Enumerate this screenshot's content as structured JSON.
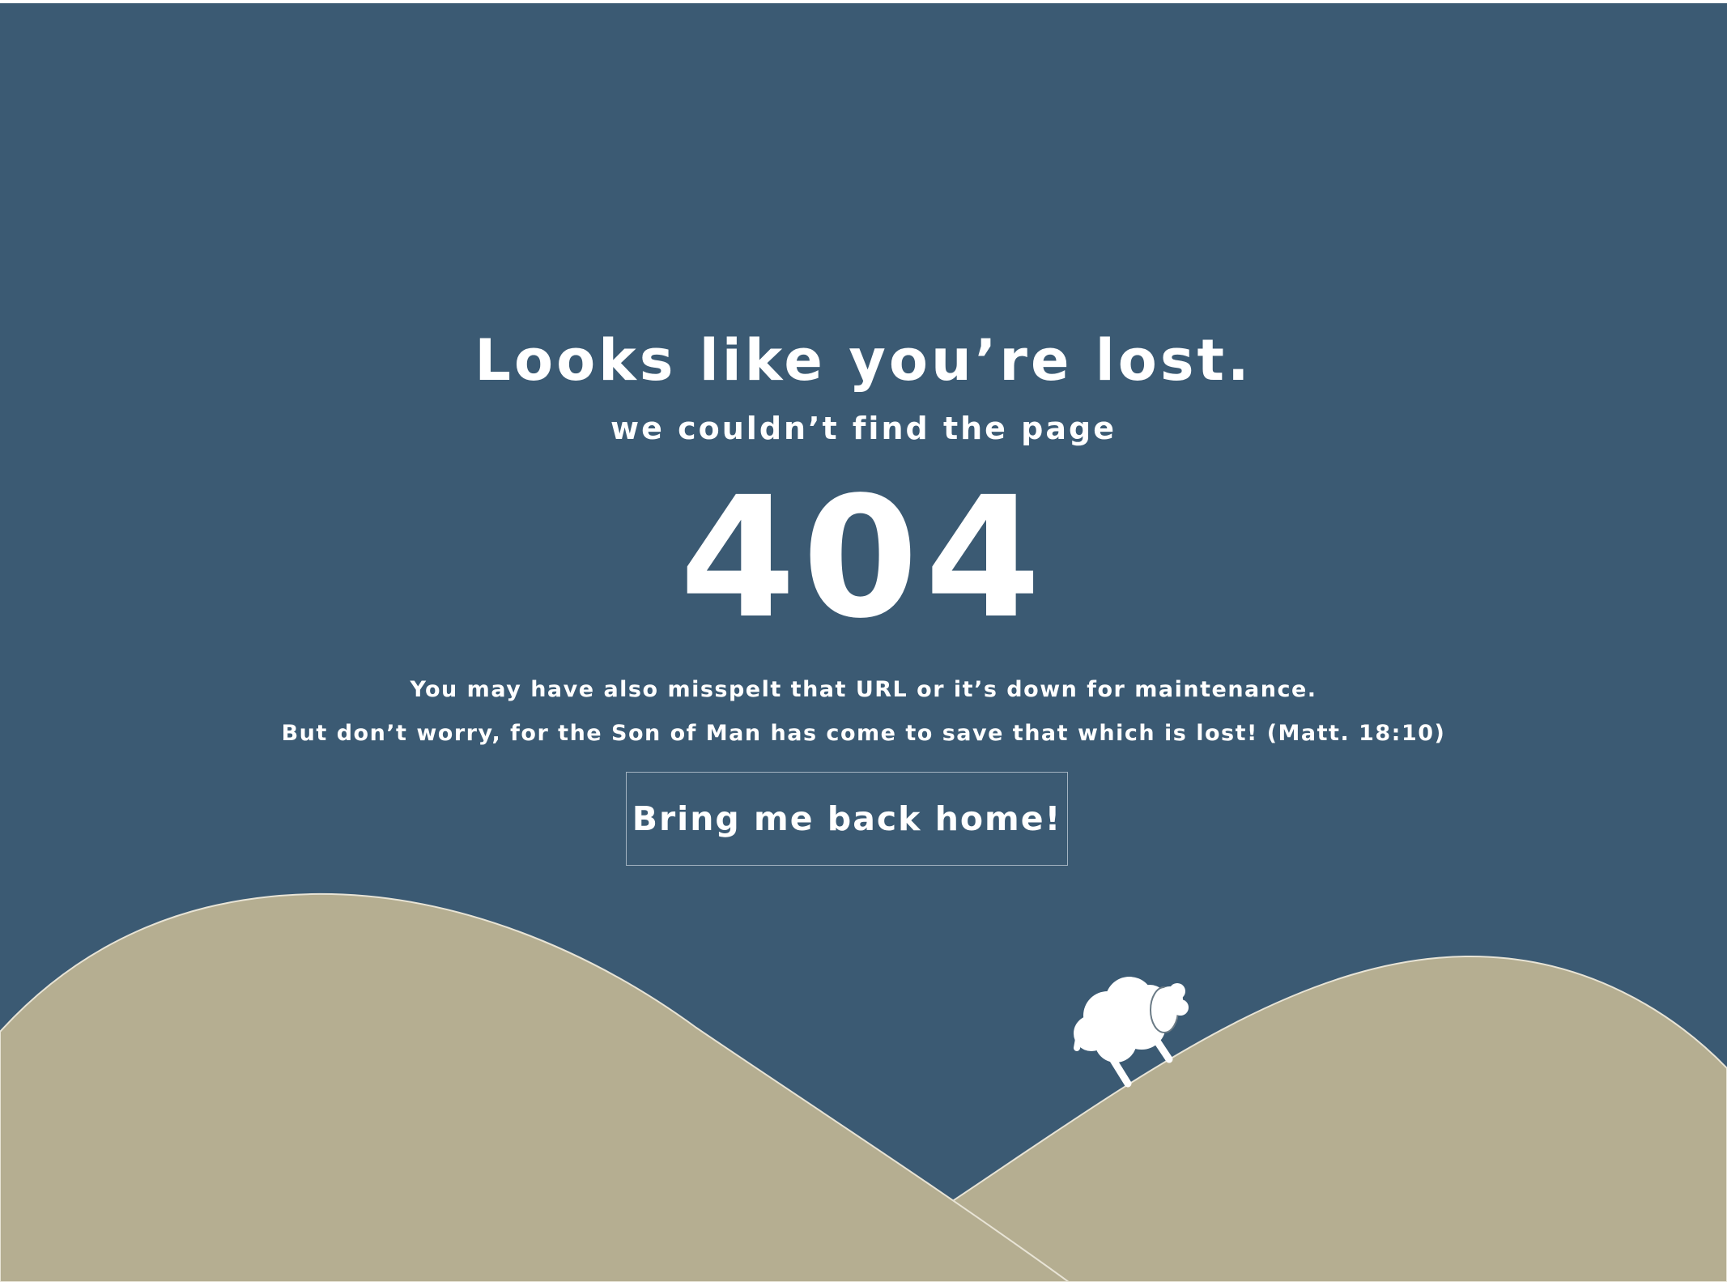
{
  "heading": "Looks like you’re lost.",
  "subheading": "we couldn’t find the page",
  "error_code": "404",
  "message_line1": "You may have also misspelt that URL or it’s down for maintenance.",
  "message_line2": "But don’t worry, for the Son of Man has come to save that which is lost! (Matt. 18:10)",
  "home_button_label": "Bring me back home!",
  "colors": {
    "background": "#3b5a73",
    "hills": "#b5ae91",
    "text": "#ffffff",
    "button_border": "#a3b3c1"
  },
  "illustration": {
    "scene": "hills-icon",
    "figure": "sheep-icon"
  }
}
